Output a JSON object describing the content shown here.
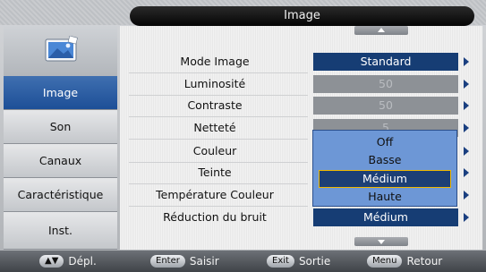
{
  "window": {
    "title": "Image"
  },
  "sidebar": {
    "items": [
      {
        "label": "Image",
        "active": true
      },
      {
        "label": "Son",
        "active": false
      },
      {
        "label": "Canaux",
        "active": false
      },
      {
        "label": "Caractéristique",
        "active": false
      },
      {
        "label": "Inst.",
        "active": false
      }
    ]
  },
  "menu": {
    "rows": [
      {
        "label": "Mode Image",
        "value": "Standard",
        "state": "selected"
      },
      {
        "label": "Luminosité",
        "value": "50",
        "state": "disabled"
      },
      {
        "label": "Contraste",
        "value": "50",
        "state": "disabled"
      },
      {
        "label": "Netteté",
        "value": "5",
        "state": "disabled"
      },
      {
        "label": "Couleur",
        "value": "",
        "state": "normal"
      },
      {
        "label": "Teinte",
        "value": "",
        "state": "normal"
      },
      {
        "label": "Température Couleur",
        "value": "",
        "state": "normal"
      },
      {
        "label": "Réduction du bruit",
        "value": "Médium",
        "state": "selected"
      }
    ]
  },
  "dropdown": {
    "options": [
      "Off",
      "Basse",
      "Médium",
      "Haute"
    ],
    "highlighted": "Médium"
  },
  "footer": {
    "move": {
      "key": "▲▼",
      "label": "Dépl."
    },
    "enter": {
      "key": "Enter",
      "label": "Saisir"
    },
    "exit": {
      "key": "Exit",
      "label": "Sortie"
    },
    "menu": {
      "key": "Menu",
      "label": "Retour"
    }
  },
  "colors": {
    "accent": "#163d74",
    "active_sidebar": "#2a5ea6",
    "dropdown": "#6d97d6",
    "highlight_border": "#f0b800"
  }
}
